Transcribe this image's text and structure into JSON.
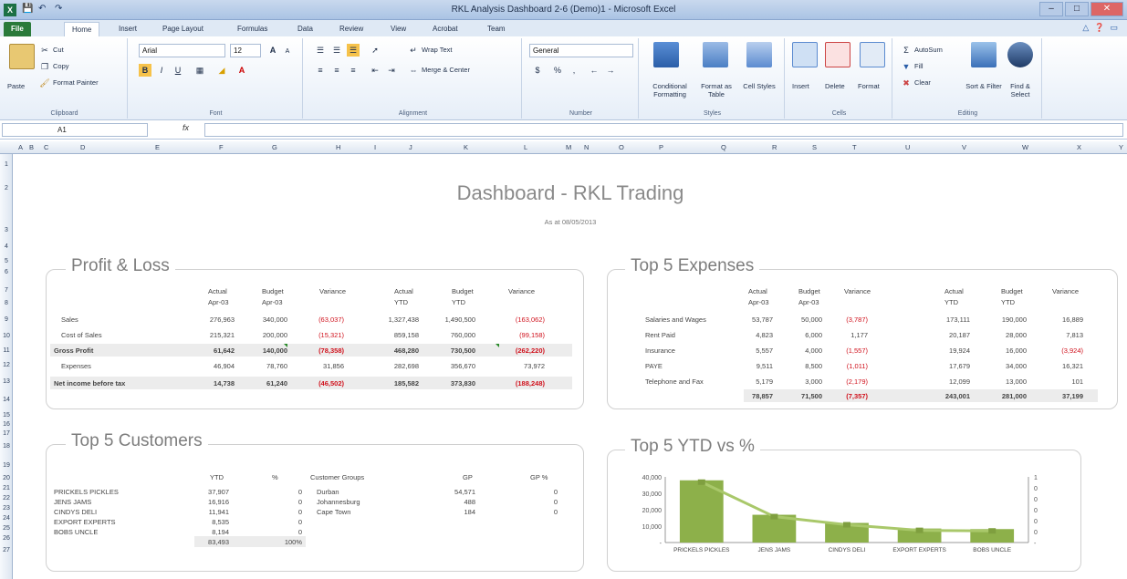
{
  "window": {
    "title": "RKL Analysis Dashboard 2-6 (Demo)1 - Microsoft Excel",
    "app_icon": "X"
  },
  "ribbon_tabs": [
    "File",
    "Home",
    "Insert",
    "Page Layout",
    "Formulas",
    "Data",
    "Review",
    "View",
    "Acrobat",
    "Team"
  ],
  "ribbon": {
    "clipboard": {
      "paste": "Paste",
      "cut": "Cut",
      "copy": "Copy",
      "format_painter": "Format Painter",
      "label": "Clipboard"
    },
    "font": {
      "name": "Arial",
      "size": "12",
      "label": "Font",
      "bold": "B",
      "italic": "I",
      "underline": "U"
    },
    "alignment": {
      "wrap": "Wrap Text",
      "merge": "Merge & Center",
      "label": "Alignment"
    },
    "number": {
      "format": "General",
      "currency": "$",
      "percent": "%",
      "comma": ",",
      "label": "Number"
    },
    "styles": {
      "conditional": "Conditional Formatting",
      "format_table": "Format as Table",
      "cell_styles": "Cell Styles",
      "label": "Styles"
    },
    "cells": {
      "insert": "Insert",
      "delete": "Delete",
      "format": "Format",
      "label": "Cells"
    },
    "editing": {
      "autosum": "AutoSum",
      "fill": "Fill",
      "clear": "Clear",
      "sort": "Sort & Filter",
      "find": "Find & Select",
      "label": "Editing"
    }
  },
  "formula_bar": {
    "name_box": "A1",
    "fx": "fx",
    "value": ""
  },
  "columns": [
    "A",
    "B",
    "C",
    "D",
    "E",
    "F",
    "G",
    "H",
    "I",
    "J",
    "K",
    "L",
    "M",
    "N",
    "O",
    "P",
    "Q",
    "R",
    "S",
    "T",
    "U",
    "V",
    "W",
    "X",
    "Y"
  ],
  "rows": [
    "1",
    "2",
    "3",
    "4",
    "5",
    "6",
    "7",
    "8",
    "9",
    "10",
    "11",
    "12",
    "13",
    "14",
    "15",
    "16",
    "17",
    "18",
    "19",
    "20",
    "21",
    "22",
    "23",
    "24",
    "25",
    "26",
    "27"
  ],
  "dashboard": {
    "title": "Dashboard - RKL Trading",
    "subtitle": "As at 08/05/2013"
  },
  "pl": {
    "title": "Profit & Loss",
    "headers": [
      [
        "Actual",
        "Apr-03"
      ],
      [
        "Budget",
        "Apr-03"
      ],
      [
        "Variance",
        ""
      ],
      [
        "Actual",
        "YTD"
      ],
      [
        "Budget",
        "YTD"
      ],
      [
        "Variance",
        ""
      ]
    ],
    "rows": [
      {
        "label": "Sales",
        "values": [
          "276,963",
          "340,000",
          "(63,037)",
          "1,327,438",
          "1,490,500",
          "(163,062)"
        ],
        "indent": true
      },
      {
        "label": "Cost of Sales",
        "values": [
          "215,321",
          "200,000",
          "(15,321)",
          "859,158",
          "760,000",
          "(99,158)"
        ],
        "indent": true
      },
      {
        "label": "Gross Profit",
        "values": [
          "61,642",
          "140,000",
          "(78,358)",
          "468,280",
          "730,500",
          "(262,220)"
        ],
        "bold": true
      },
      {
        "label": "Expenses",
        "values": [
          "46,904",
          "78,760",
          "31,856",
          "282,698",
          "356,670",
          "73,972"
        ],
        "indent": true
      },
      {
        "label": "Net income before tax",
        "values": [
          "14,738",
          "61,240",
          "(46,502)",
          "185,582",
          "373,830",
          "(188,248)"
        ],
        "bold": true
      }
    ]
  },
  "expenses": {
    "title": "Top 5 Expenses",
    "headers": [
      [
        "Actual",
        "Apr-03"
      ],
      [
        "Budget",
        "Apr-03"
      ],
      [
        "Variance",
        ""
      ],
      [
        "Actual",
        "YTD"
      ],
      [
        "Budget",
        "YTD"
      ],
      [
        "Variance",
        ""
      ]
    ],
    "rows": [
      {
        "label": "Salaries and Wages",
        "values": [
          "53,787",
          "50,000",
          "(3,787)",
          "173,111",
          "190,000",
          "16,889"
        ]
      },
      {
        "label": "Rent Paid",
        "values": [
          "4,823",
          "6,000",
          "1,177",
          "20,187",
          "28,000",
          "7,813"
        ]
      },
      {
        "label": "Insurance",
        "values": [
          "5,557",
          "4,000",
          "(1,557)",
          "19,924",
          "16,000",
          "(3,924)"
        ]
      },
      {
        "label": "PAYE",
        "values": [
          "9,511",
          "8,500",
          "(1,011)",
          "17,679",
          "34,000",
          "16,321"
        ]
      },
      {
        "label": "Telephone and Fax",
        "values": [
          "5,179",
          "3,000",
          "(2,179)",
          "12,099",
          "13,000",
          "101"
        ]
      }
    ],
    "totals": [
      "78,857",
      "71,500",
      "(7,357)",
      "243,001",
      "281,000",
      "37,199"
    ]
  },
  "customers": {
    "title": "Top 5 Customers",
    "headers": {
      "ytd": "YTD",
      "pct": "%",
      "groups": "Customer Groups",
      "gp": "GP",
      "gppct": "GP %"
    },
    "rows": [
      {
        "name": "PRICKELS PICKLES",
        "ytd": "37,907",
        "pct": "0"
      },
      {
        "name": "JENS JAMS",
        "ytd": "16,916",
        "pct": "0"
      },
      {
        "name": "CINDYS DELI",
        "ytd": "11,941",
        "pct": "0"
      },
      {
        "name": "EXPORT EXPERTS",
        "ytd": "8,535",
        "pct": "0"
      },
      {
        "name": "BOBS UNCLE",
        "ytd": "8,194",
        "pct": "0"
      }
    ],
    "total_ytd": "83,493",
    "total_pct": "100%",
    "groups": [
      {
        "name": "Durban",
        "gp": "54,571",
        "gppct": "0"
      },
      {
        "name": "Johannesburg",
        "gp": "488",
        "gppct": "0"
      },
      {
        "name": "Cape Town",
        "gp": "184",
        "gppct": "0"
      }
    ]
  },
  "chart_panel_title": "Top 5 YTD vs %",
  "chart_data": {
    "type": "bar",
    "categories": [
      "PRICKELS PICKLES",
      "JENS JAMS",
      "CINDYS DELI",
      "EXPORT EXPERTS",
      "BOBS UNCLE"
    ],
    "series": [
      {
        "values": [
          37907,
          16916,
          11941,
          8535,
          8194
        ]
      },
      {
        "values": [
          0.45,
          0.2,
          0.14,
          0.1,
          0.1
        ]
      }
    ],
    "ylim": [
      0,
      40000
    ],
    "yticks": [
      "40,000",
      "30,000",
      "20,000",
      "10,000",
      "-"
    ],
    "y2ticks": [
      "1",
      "0",
      "0",
      "0",
      "0",
      "0",
      "-"
    ],
    "bar_color": "#8db04a",
    "line_color": "#a9c86a"
  }
}
